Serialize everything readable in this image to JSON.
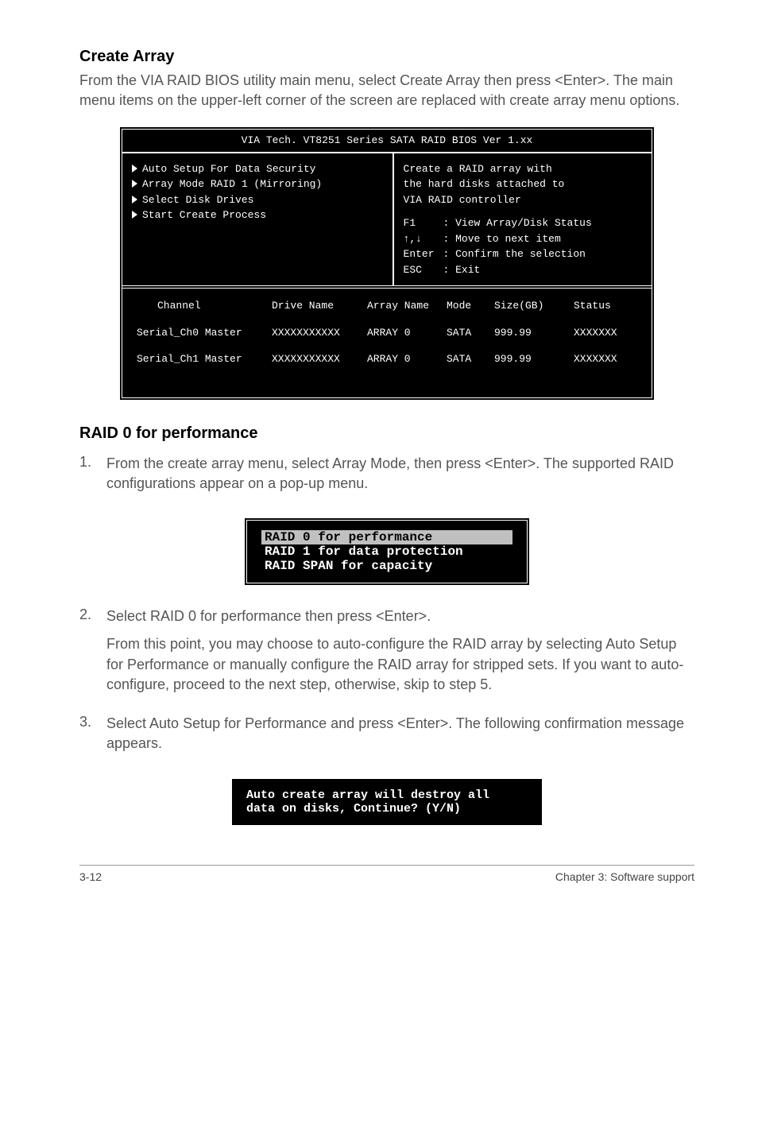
{
  "heading1": "Create Array",
  "intro": "From the VIA RAID BIOS utility main menu, select Create Array then   press <Enter>. The main menu items on the upper-left corner of the screen are replaced with create array menu options.",
  "bios": {
    "title": "VIA Tech. VT8251 Series SATA RAID BIOS Ver 1.xx",
    "menu": {
      "items": [
        "Auto Setup For Data Security",
        "Array Mode RAID 1 (Mirroring)",
        "Select Disk Drives",
        "Start Create Process"
      ]
    },
    "right": {
      "desc1": "Create a RAID array with",
      "desc2": "the hard disks attached to",
      "desc3": "VIA RAID controller",
      "help1_key": "F1",
      "help1_txt": ": View Array/Disk Status",
      "help2_key": "↑,↓",
      "help2_txt": ": Move to next item",
      "help3_key": "Enter",
      "help3_txt": ": Confirm the selection",
      "help4_key": "ESC",
      "help4_txt": ": Exit"
    },
    "table": {
      "head_channel": "Channel",
      "head_drive": "Drive Name",
      "head_array": "Array Name",
      "head_mode": "Mode",
      "head_size": "Size(GB)",
      "head_status": "Status",
      "rows": [
        {
          "ch": "Serial_Ch0 Master",
          "dn": "XXXXXXXXXXX",
          "an": "ARRAY 0",
          "md": "SATA",
          "sz": "999.99",
          "st": "XXXXXXX"
        },
        {
          "ch": "Serial_Ch1 Master",
          "dn": "XXXXXXXXXXX",
          "an": "ARRAY 0",
          "md": "SATA",
          "sz": "999.99",
          "st": "XXXXXXX"
        }
      ]
    }
  },
  "heading2": "RAID 0 for performance",
  "step1": "From the create array menu, select Array Mode, then press <Enter>. The supported RAID configurations appear on a pop-up menu.",
  "popup": {
    "opt0": "RAID 0 for performance",
    "opt1": "RAID 1 for data protection",
    "opt2": "RAID SPAN for capacity"
  },
  "step2a": "Select RAID 0 for performance then press <Enter>.",
  "step2b": "From this point, you may choose to auto-configure the RAID array by selecting Auto Setup for Performance or manually configure the RAID array for stripped sets.  If you want to auto-configure, proceed to the next step, otherwise, skip to step 5.",
  "step3": "Select  Auto Setup for Performance and press <Enter>. The following confirmation message appears.",
  "confirm": {
    "l1": "Auto create array will destroy all",
    "l2": "data on disks, Continue? (Y/N)"
  },
  "footer_left": "3-12",
  "footer_right": "Chapter 3: Software support"
}
